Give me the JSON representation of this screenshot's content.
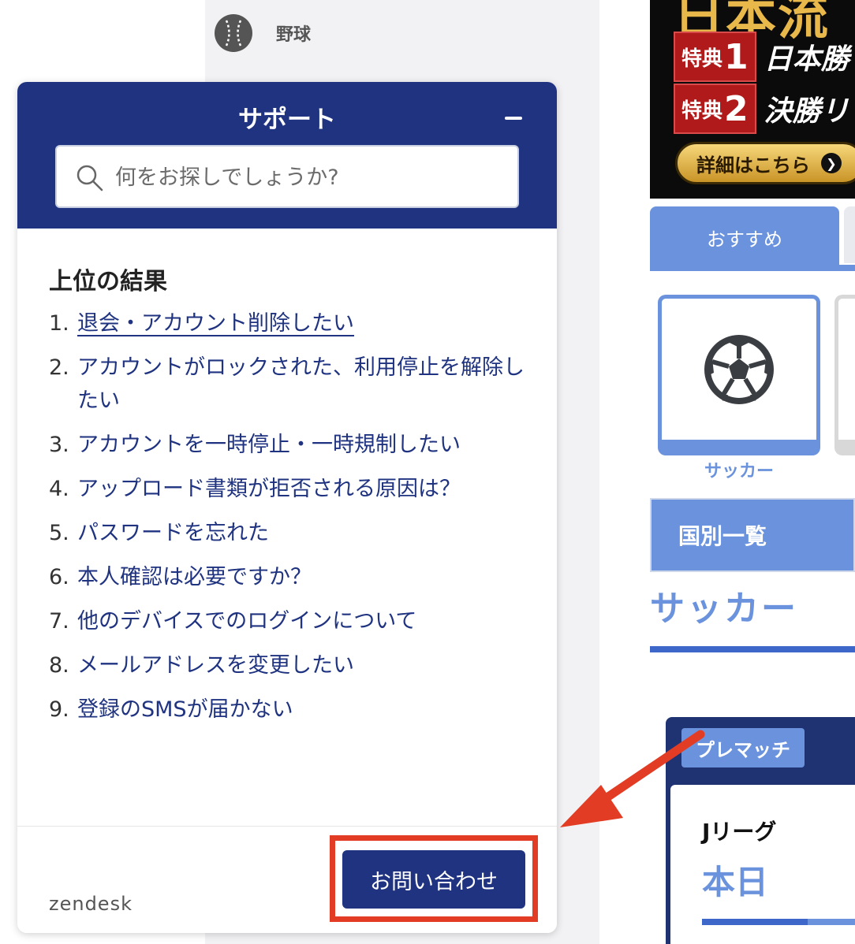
{
  "background": {
    "sport_item_label": "野球",
    "banner": {
      "title": "日本流",
      "perks": [
        {
          "tag": "特典",
          "num": "1",
          "text": "日本勝"
        },
        {
          "tag": "特典",
          "num": "2",
          "text": "決勝リ"
        }
      ],
      "button_label": "詳細はこちら"
    },
    "tabs": {
      "active": "おすすめ"
    },
    "sport_card_label": "サッカー",
    "country_list_label": "国別一覧",
    "section_heading": "サッカー",
    "match": {
      "badge": "プレマッチ",
      "league": "Jリーグ",
      "day": "本日"
    }
  },
  "widget": {
    "title": "サポート",
    "search": {
      "placeholder": "何をお探しでしょうか?"
    },
    "results_heading": "上位の結果",
    "results": [
      {
        "num": "1.",
        "label": "退会・アカウント削除したい"
      },
      {
        "num": "2.",
        "label": "アカウントがロックされた、利用停止を解除したい"
      },
      {
        "num": "3.",
        "label": "アカウントを一時停止・一時規制したい"
      },
      {
        "num": "4.",
        "label": "アップロード書類が拒否される原因は？"
      },
      {
        "num": "5.",
        "label": "パスワードを忘れた"
      },
      {
        "num": "6.",
        "label": "本人確認は必要ですか？"
      },
      {
        "num": "7.",
        "label": "他のデバイスでのログインについて"
      },
      {
        "num": "8.",
        "label": "メールアドレスを変更したい"
      },
      {
        "num": "9.",
        "label": "登録のSMSが届かない"
      }
    ],
    "footer": {
      "logo_text": "zendesk",
      "contact_label": "お問い合わせ"
    }
  },
  "colors": {
    "header_navy": "#1f3380",
    "accent_blue": "#6b93dd",
    "annotation_red": "#e23d24"
  }
}
